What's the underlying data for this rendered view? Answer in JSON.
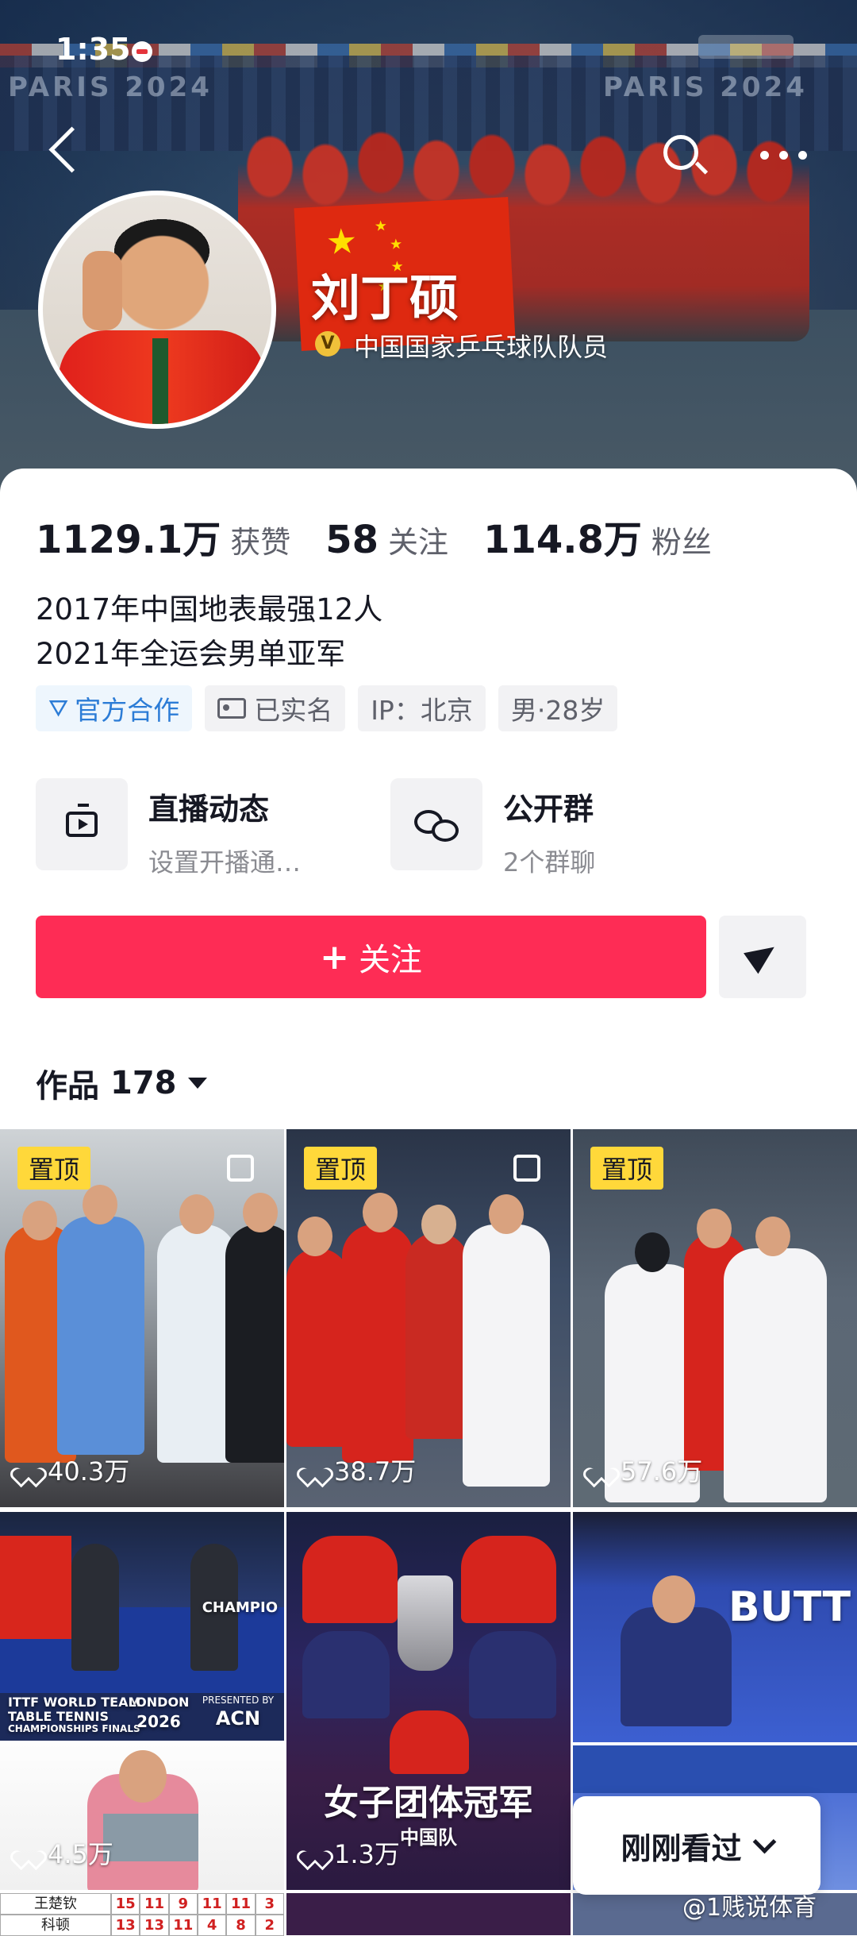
{
  "status": {
    "time": "1:35"
  },
  "banner": {
    "paris_text": "PARIS 2024"
  },
  "profile": {
    "name": "刘丁硕",
    "verify_badge": "V",
    "verify_text": "中国国家乒乓球队队员",
    "stats": [
      {
        "value": "1129.1万",
        "label": "获赞"
      },
      {
        "value": "58",
        "label": "关注"
      },
      {
        "value": "114.8万",
        "label": "粉丝"
      }
    ],
    "bio": [
      "2017年中国地表最强12人",
      "2021年全运会男单亚军"
    ],
    "tags": [
      {
        "label": "官方合作",
        "icon": "official-icon"
      },
      {
        "label": "已实名",
        "icon": "id-card-icon"
      },
      {
        "label": "IP：北京"
      },
      {
        "label": "男·28岁"
      }
    ]
  },
  "features": {
    "live": {
      "title": "直播动态",
      "subtitle": "设置开播通…",
      "icon": "tv-icon"
    },
    "group": {
      "title": "公开群",
      "subtitle": "2个群聊",
      "icon": "chat-icon"
    }
  },
  "actions": {
    "follow_label": "关注",
    "follow_icon": "plus-icon",
    "share_icon": "send-icon"
  },
  "works": {
    "label": "作品",
    "count": "178"
  },
  "grid": [
    {
      "pinned": "置顶",
      "likes": "40.3万"
    },
    {
      "pinned": "置顶",
      "likes": "38.7万"
    },
    {
      "pinned": "置顶",
      "likes": "57.6万"
    },
    {
      "likes": "4.5万",
      "text": {
        "line1": "ITTF WORLD TEAM",
        "line2": "TABLE TENNIS",
        "line3": "CHAMPIONSHIPS FINALS",
        "city": "LONDON",
        "year": "2026",
        "sponsor_line": "PRESENTED BY",
        "sponsor": "ACN",
        "banner": "CHAMPIO"
      }
    },
    {
      "likes": "1.3万",
      "text": {
        "title": "女子团体冠军",
        "sub": "中国队"
      }
    },
    {
      "text": {
        "banner": "BUTT"
      }
    }
  ],
  "score_strip": {
    "rows": [
      {
        "name": "王楚钦",
        "scores": [
          "15",
          "11",
          "9",
          "11",
          "11",
          "3"
        ]
      },
      {
        "name": "科顿",
        "scores": [
          "13",
          "13",
          "11",
          "4",
          "8",
          "2"
        ]
      }
    ]
  },
  "recently_viewed": "刚刚看过",
  "watermark": "@1贱说体育",
  "colors": {
    "accent": "#fe2c55",
    "pin": "#ffd83a",
    "official": "#2c7cd6",
    "verify": "#f0c13a"
  }
}
